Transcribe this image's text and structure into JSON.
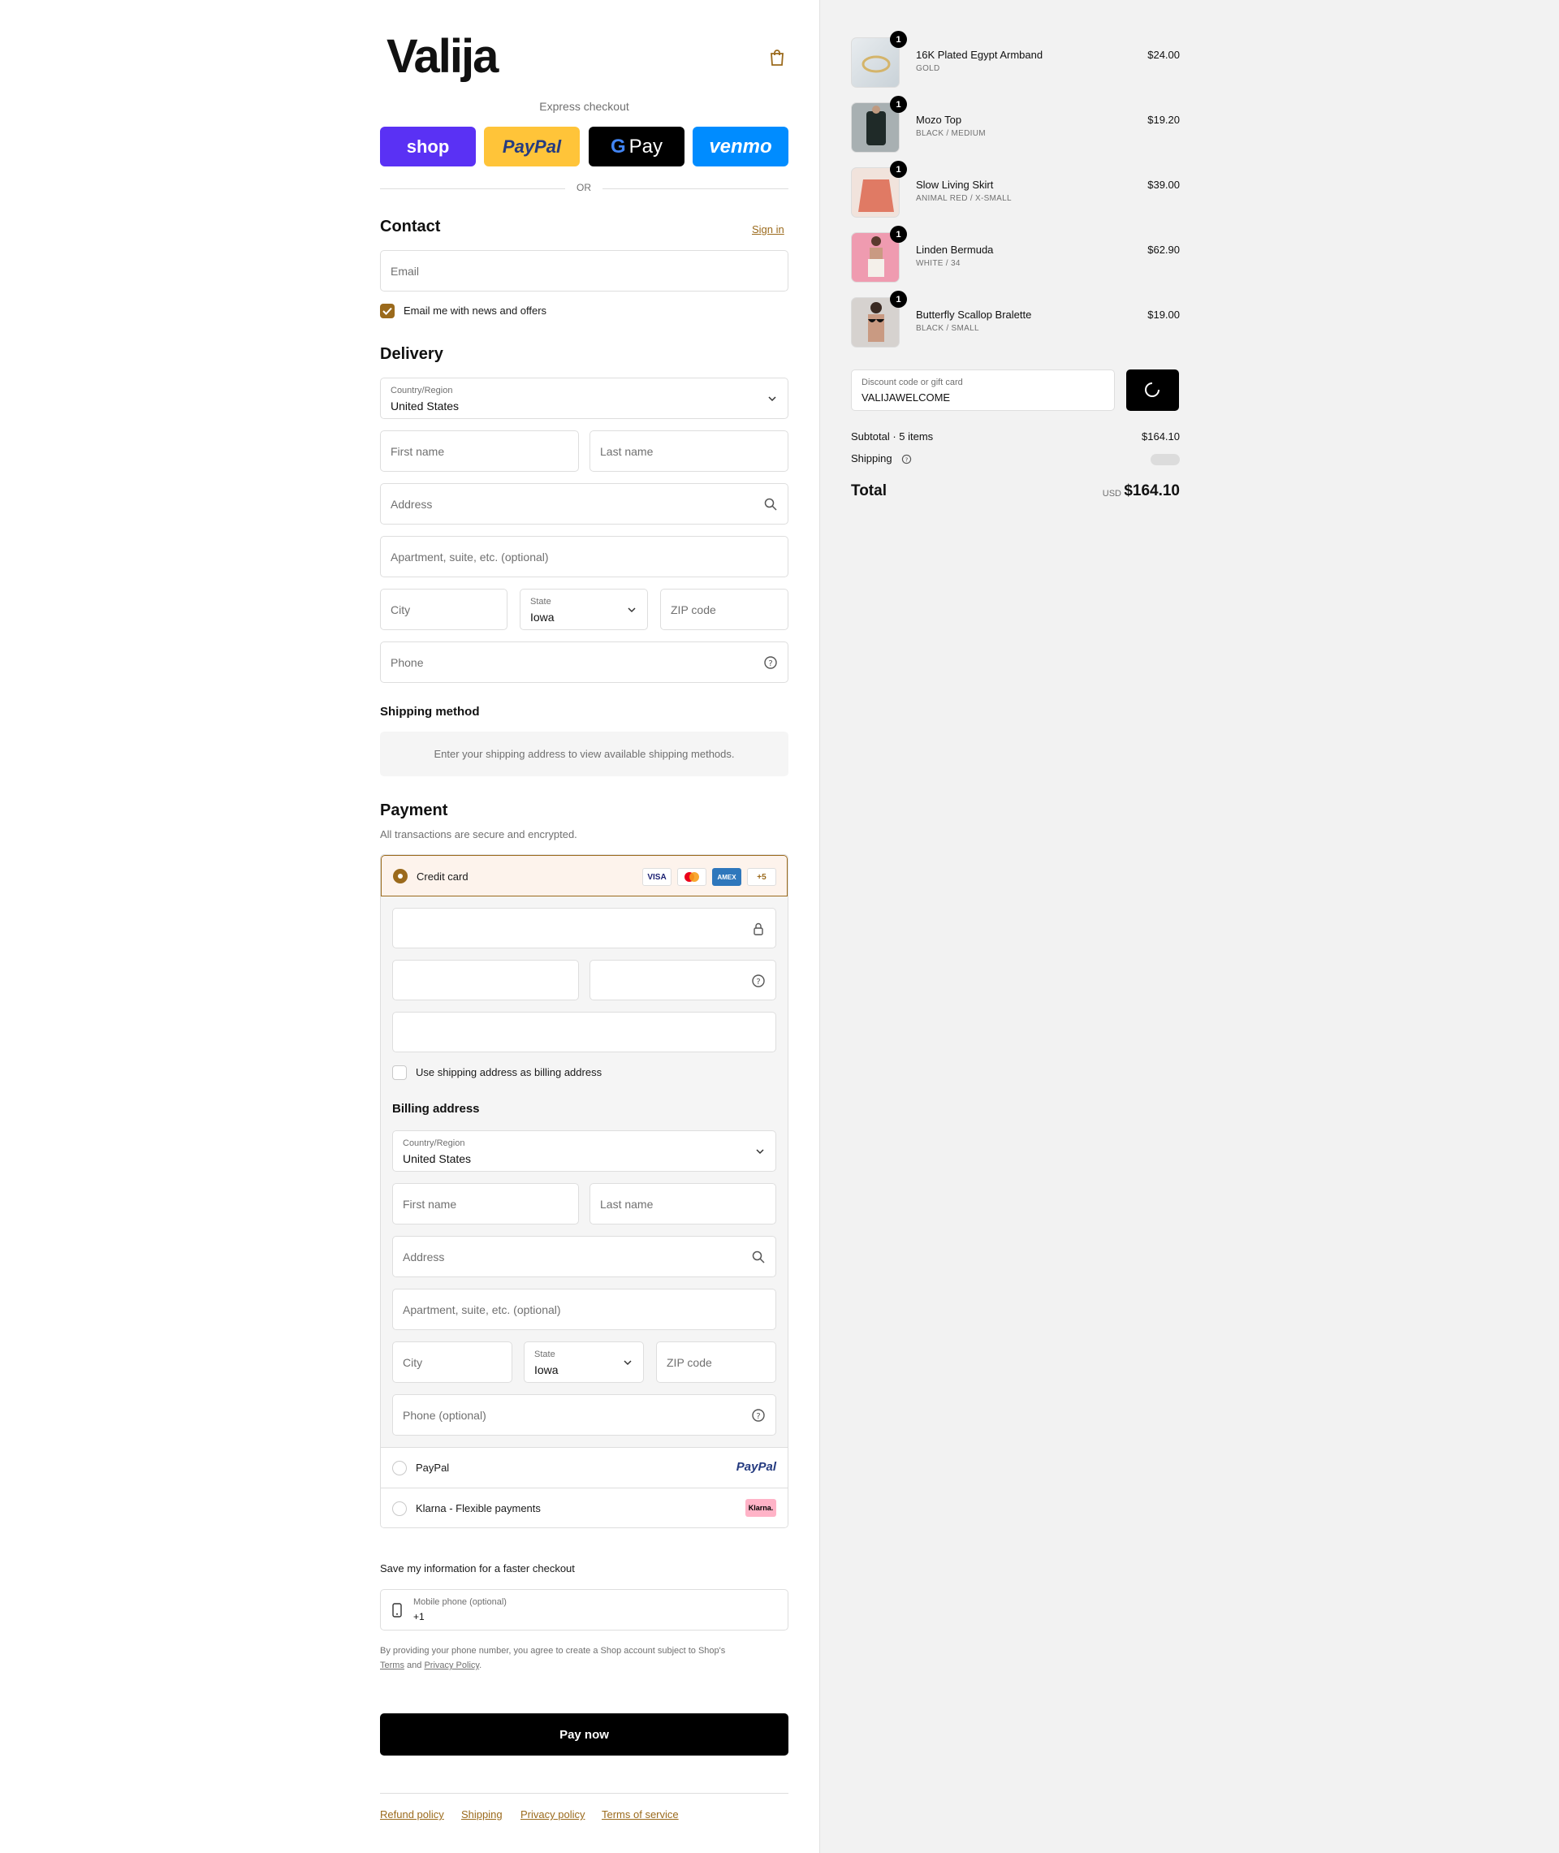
{
  "brand": {
    "logo": "Valija",
    "accent": "#9b6a1c"
  },
  "express": {
    "label": "Express checkout",
    "buttons": {
      "shop": "shop",
      "paypal": "PayPal",
      "gpay": "Pay",
      "venmo": "venmo"
    },
    "or": "OR"
  },
  "contact": {
    "title": "Contact",
    "sign_in": "Sign in",
    "email_placeholder": "Email",
    "newsletter": "Email me with news and offers"
  },
  "delivery": {
    "title": "Delivery",
    "country_label": "Country/Region",
    "country_value": "United States",
    "first_name": "First name",
    "last_name": "Last name",
    "address": "Address",
    "apartment": "Apartment, suite, etc. (optional)",
    "city": "City",
    "state_label": "State",
    "state_value": "Iowa",
    "zip": "ZIP code",
    "phone": "Phone"
  },
  "shipping_method": {
    "title": "Shipping method",
    "note": "Enter your shipping address to view available shipping methods."
  },
  "payment": {
    "title": "Payment",
    "subtitle": "All transactions are secure and encrypted.",
    "credit_card": "Credit card",
    "badges": {
      "visa": "VISA",
      "amex": "AMEX",
      "more": "+5"
    },
    "use_shipping": "Use shipping address as billing address",
    "billing": {
      "title": "Billing address",
      "country_label": "Country/Region",
      "country_value": "United States",
      "first_name": "First name",
      "last_name": "Last name",
      "address": "Address",
      "apartment": "Apartment, suite, etc. (optional)",
      "city": "City",
      "state_label": "State",
      "state_value": "Iowa",
      "zip": "ZIP code",
      "phone": "Phone (optional)"
    },
    "paypal": "PayPal",
    "paypal_logo": "PayPal",
    "klarna": "Klarna - Flexible payments",
    "klarna_logo": "Klarna."
  },
  "save_info": {
    "title": "Save my information for a faster checkout",
    "mobile_label": "Mobile phone (optional)",
    "mobile_value": "+1",
    "legal_prefix": "By providing your phone number, you agree to create a Shop account subject to Shop's",
    "terms": "Terms",
    "and": "and",
    "privacy": "Privacy Policy",
    "period": "."
  },
  "pay_now": "Pay now",
  "footer": {
    "links": [
      "Refund policy",
      "Shipping",
      "Privacy policy",
      "Terms of service"
    ]
  },
  "cart": {
    "items": [
      {
        "name": "16K Plated Egypt Armband",
        "variant": "GOLD",
        "price": "$24.00",
        "qty": "1"
      },
      {
        "name": "Mozo Top",
        "variant": "BLACK / MEDIUM",
        "price": "$19.20",
        "qty": "1"
      },
      {
        "name": "Slow Living Skirt",
        "variant": "ANIMAL RED / X-SMALL",
        "price": "$39.00",
        "qty": "1"
      },
      {
        "name": "Linden Bermuda",
        "variant": "WHITE / 34",
        "price": "$62.90",
        "qty": "1"
      },
      {
        "name": "Butterfly Scallop Bralette",
        "variant": "BLACK / SMALL",
        "price": "$19.00",
        "qty": "1"
      }
    ],
    "discount_label": "Discount code or gift card",
    "discount_value": "VALIJAWELCOME",
    "subtotal_label": "Subtotal · 5 items",
    "subtotal_value": "$164.10",
    "shipping_label": "Shipping",
    "total_label": "Total",
    "currency": "USD",
    "total_value": "$164.10"
  }
}
